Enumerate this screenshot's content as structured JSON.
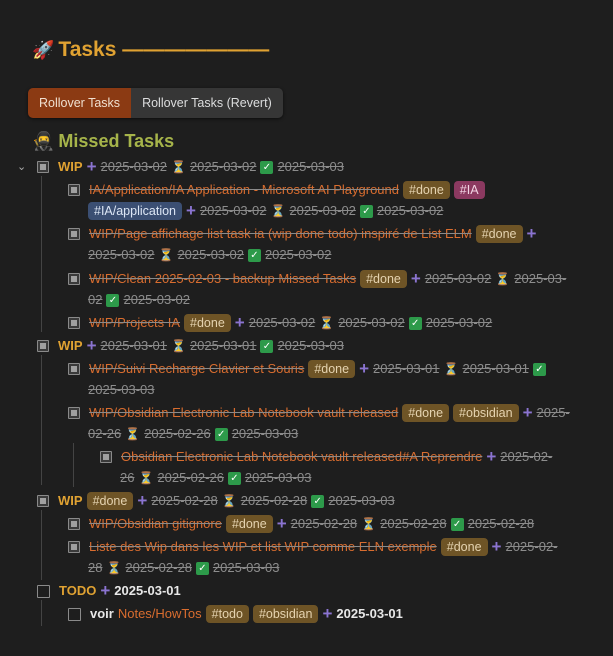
{
  "title": "Tasks ———————",
  "buttons": {
    "rollover": "Rollover Tasks",
    "revert": "Rollover Tasks (Revert)"
  },
  "section": "Missed Tasks",
  "groups": [
    {
      "label": "WIP",
      "dates": [
        "2025-03-02",
        "2025-03-02",
        "2025-03-03"
      ]
    },
    {
      "label": "WIP",
      "dates": [
        "2025-03-01",
        "2025-03-01",
        "2025-03-03"
      ]
    },
    {
      "label": "WIP",
      "tag": "#done",
      "dates": [
        "2025-02-28",
        "2025-02-28",
        "2025-03-03"
      ]
    }
  ],
  "items": {
    "ia_title": "IA/Application/IA Application - Microsoft AI Playground",
    "ia_tag_done": "#done",
    "ia_tag_ia": "#IA",
    "ia_tag_app": "#IA/application",
    "ia_dates": [
      "2025-03-02",
      "2025-03-02",
      "2025-03-02"
    ],
    "page_title": "WIP/Page affichage list task ia (wip done todo) inspiré de List ELM",
    "page_tag": "#done",
    "page_dates": [
      "2025-03-02",
      "2025-03-02",
      "2025-03-02"
    ],
    "clean_title": "WIP/Clean 2025-02-03 - backup Missed Tasks",
    "clean_tag": "#done",
    "clean_d1": "2025-03-02",
    "clean_d2a": "2025-03-",
    "clean_d2b": "02",
    "clean_d3": "2025-03-02",
    "proj_title": "WIP/Projects IA",
    "proj_tag": "#done",
    "proj_dates": [
      "2025-03-02",
      "2025-03-02",
      "2025-03-02"
    ],
    "suivi_title": "WIP/Suivi Recharge Clavier et Souris",
    "suivi_tag": "#done",
    "suivi_dates": [
      "2025-03-01",
      "2025-03-01",
      "2025-03-03"
    ],
    "obs_title": "WIP/Obsidian Electronic Lab Notebook vault released",
    "obs_tag_done": "#done",
    "obs_tag_obs": "#obsidian",
    "obs_d1a": "2025-",
    "obs_d1b": "02-26",
    "obs_d2": "2025-02-26",
    "obs_d3": "2025-03-03",
    "obs_sub_title": "Obsidian Electronic Lab Notebook vault released#A Reprendre",
    "obs_sub_d1a": "2025-02-",
    "obs_sub_d1b": "26",
    "obs_sub_d2": "2025-02-26",
    "obs_sub_d3": "2025-03-03",
    "git_title": "WIP/Obsidian gitignore",
    "git_tag": "#done",
    "git_dates": [
      "2025-02-28",
      "2025-02-28",
      "2025-02-28"
    ],
    "liste_title": "Liste des Wip dans les WIP et list WIP comme ELN exemple",
    "liste_tag": "#done",
    "liste_d1a": "2025-02-",
    "liste_d1b": "28",
    "liste_d2": "2025-02-28",
    "liste_d3": "2025-03-03"
  },
  "todo": {
    "label": "TODO",
    "date": "2025-03-01"
  },
  "voir": {
    "word": "voir",
    "link": "Notes/HowTos",
    "tag1": "#todo",
    "tag2": "#obsidian",
    "date": "2025-03-01"
  },
  "icons": [
    "rocket-icon",
    "ninja-icon",
    "plus-icon",
    "scheduled-icon",
    "check-icon",
    "caret-down-icon"
  ]
}
